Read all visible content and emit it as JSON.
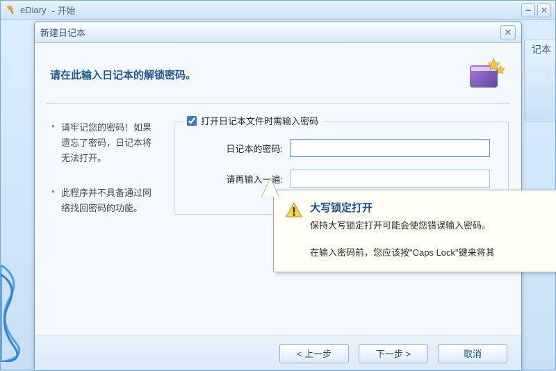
{
  "outer": {
    "app_name": "eDiary",
    "title_suffix": "- 开始",
    "bg_label": "记本"
  },
  "dialog": {
    "title": "新建日记本",
    "prompt": "请在此输入日记本的解锁密码。"
  },
  "info": {
    "item1": "请牢记您的密码！如果遗忘了密码，日记本将无法打开。",
    "item2": "此程序并不具备通过网络找回密码的功能。"
  },
  "form": {
    "checkbox_label": "打开日记本文件时需输入密码",
    "checkbox_checked": true,
    "password_label": "日记本的密码:",
    "password_value": "",
    "confirm_label": "请再输入一遍:",
    "confirm_value": ""
  },
  "tooltip": {
    "title": "大写锁定打开",
    "line1": "保持大写锁定打开可能会使您错误输入密码。",
    "line2": "在输入密码前，您应该按\"Caps Lock\"键来将其"
  },
  "buttons": {
    "prev": "< 上一步",
    "next": "下一步 >",
    "cancel": "取消"
  }
}
